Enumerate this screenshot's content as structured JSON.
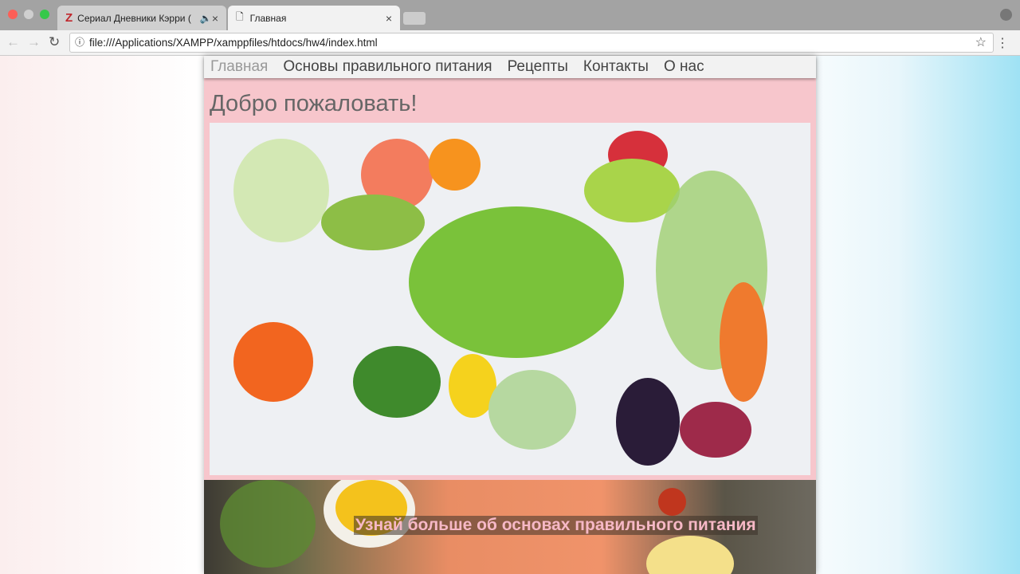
{
  "browser": {
    "tabs": [
      {
        "label": "Сериал Дневники Кэрри (",
        "icon": "z-favicon",
        "audio": true
      },
      {
        "label": "Главная",
        "icon": "page-icon"
      }
    ],
    "url": "file:///Applications/XAMPP/xamppfiles/htdocs/hw4/index.html"
  },
  "site": {
    "menu": [
      "Главная",
      "Основы правильного питания",
      "Рецепты",
      "Контакты",
      "О нас"
    ],
    "title": "Добро пожаловать!",
    "banner_caption": "Узнай больше об основах правильного питания",
    "accent": "#f7c6cc"
  }
}
